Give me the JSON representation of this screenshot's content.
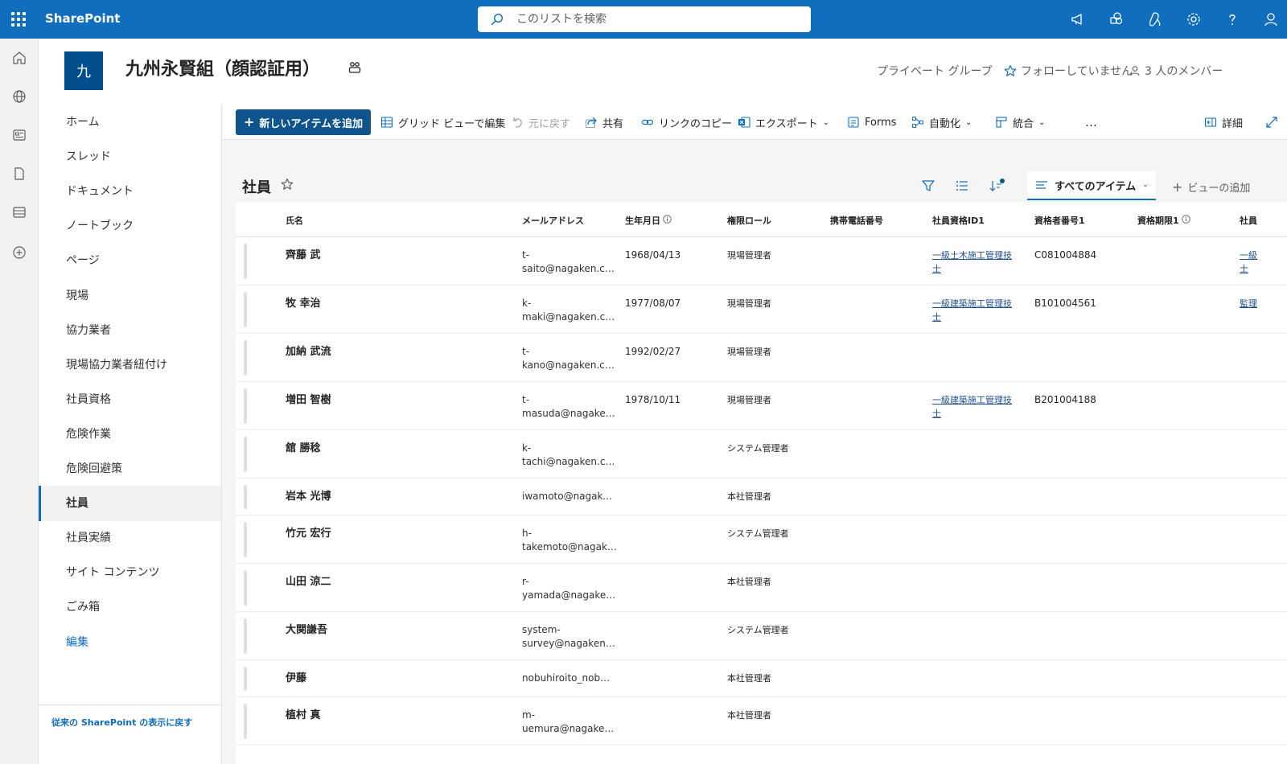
{
  "suite": {
    "brand": "SharePoint",
    "search_placeholder": "このリストを検索"
  },
  "site": {
    "logo_letter": "九",
    "title": "九州永賢組（顔認証用）",
    "privacy": "プライベート グループ",
    "follow": "フォローしていません",
    "members": "3 人のメンバー"
  },
  "nav": {
    "items": [
      {
        "label": "ホーム"
      },
      {
        "label": "スレッド"
      },
      {
        "label": "ドキュメント"
      },
      {
        "label": "ノートブック"
      },
      {
        "label": "ページ"
      },
      {
        "label": "現場"
      },
      {
        "label": "協力業者"
      },
      {
        "label": "現場協力業者紐付け"
      },
      {
        "label": "社員資格"
      },
      {
        "label": "危険作業"
      },
      {
        "label": "危険回避策"
      },
      {
        "label": "社員",
        "active": true
      },
      {
        "label": "社員実績"
      },
      {
        "label": "サイト コンテンツ"
      },
      {
        "label": "ごみ箱"
      }
    ],
    "edit_label": "編集",
    "classic_link": "従来の SharePoint の表示に戻す"
  },
  "commands": {
    "new_item": "新しいアイテムを追加",
    "grid_edit": "グリッド ビューで編集",
    "undo": "元に戻す",
    "share": "共有",
    "copy_link": "リンクのコピー",
    "export": "エクスポート",
    "forms": "Forms",
    "automate": "自動化",
    "integrate": "統合",
    "more": "…",
    "details": "詳細"
  },
  "list": {
    "title": "社員",
    "view_name": "すべてのアイテム",
    "add_view": "ビューの追加",
    "columns": [
      "氏名",
      "メールアドレス",
      "生年月日",
      "権限ロール",
      "携帯電話番号",
      "社員資格ID1",
      "資格者番号1",
      "資格期限1",
      "社員"
    ],
    "rows": [
      {
        "name": "齊藤 武",
        "email1": "t-",
        "email2": "saito@nagaken.c…",
        "birth": "1968/04/13",
        "role": "現場管理者",
        "qual1": "一級土木施工管理技",
        "qual2": "士",
        "number": "C081004884",
        "extra1": "一級",
        "extra2": "士"
      },
      {
        "name": "牧 幸治",
        "email1": "k-",
        "email2": "maki@nagaken.com",
        "birth": "1977/08/07",
        "role": "現場管理者",
        "qual1": "一級建築施工管理技",
        "qual2": "士",
        "number": "B101004561",
        "extra1": "監理",
        "extra2": ""
      },
      {
        "name": "加納 武流",
        "email1": "t-",
        "email2": "kano@nagaken.com",
        "birth": "1992/02/27",
        "role": "現場管理者",
        "qual1": "",
        "qual2": "",
        "number": "",
        "extra1": "",
        "extra2": ""
      },
      {
        "name": "増田 智樹",
        "email1": "t-",
        "email2": "masuda@nagake…",
        "birth": "1978/10/11",
        "role": "現場管理者",
        "qual1": "一級建築施工管理技",
        "qual2": "士",
        "number": "B201004188",
        "extra1": "",
        "extra2": ""
      },
      {
        "name": "舘 勝稔",
        "email1": "k-",
        "email2": "tachi@nagaken.c…",
        "birth": "",
        "role": "システム管理者",
        "qual1": "",
        "qual2": "",
        "number": "",
        "extra1": "",
        "extra2": ""
      },
      {
        "name": "岩本 光博",
        "email1": "iwamoto@nagake…",
        "email2": "",
        "birth": "",
        "role": "本社管理者",
        "qual1": "",
        "qual2": "",
        "number": "",
        "extra1": "",
        "extra2": ""
      },
      {
        "name": "竹元 宏行",
        "email1": "h-",
        "email2": "takemoto@nagak…",
        "birth": "",
        "role": "システム管理者",
        "qual1": "",
        "qual2": "",
        "number": "",
        "extra1": "",
        "extra2": ""
      },
      {
        "name": "山田 涼二",
        "email1": "r-",
        "email2": "yamada@nagake…",
        "birth": "",
        "role": "本社管理者",
        "qual1": "",
        "qual2": "",
        "number": "",
        "extra1": "",
        "extra2": ""
      },
      {
        "name": "大関謙吾",
        "email1": "system-",
        "email2": "survey@nagaken.…",
        "birth": "",
        "role": "システム管理者",
        "qual1": "",
        "qual2": "",
        "number": "",
        "extra1": "",
        "extra2": ""
      },
      {
        "name": "伊藤",
        "email1": "nobuhiroito_nob…",
        "email2": "",
        "birth": "",
        "role": "本社管理者",
        "qual1": "",
        "qual2": "",
        "number": "",
        "extra1": "",
        "extra2": ""
      },
      {
        "name": "植村 真",
        "email1": "m-",
        "email2": "uemura@nagaken…",
        "birth": "",
        "role": "本社管理者",
        "qual1": "",
        "qual2": "",
        "number": "",
        "extra1": "",
        "extra2": ""
      }
    ]
  }
}
